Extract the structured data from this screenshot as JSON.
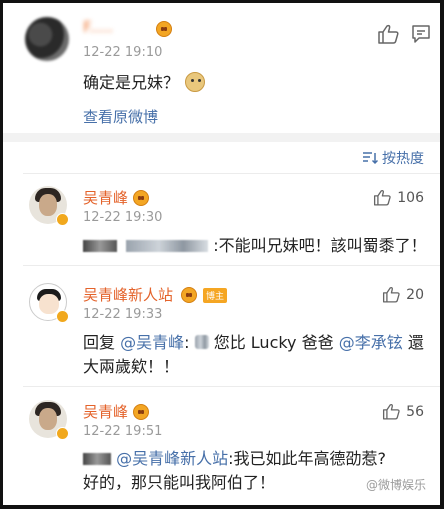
{
  "post": {
    "author_name": "F.....",
    "time": "12-22 19:10",
    "text": "确定是兄妹？",
    "view_original": "查看原微博"
  },
  "sort": {
    "label": "按热度"
  },
  "comments": [
    {
      "name": "吴青峰",
      "time": "12-22 19:30",
      "likes": "106",
      "text": ":不能叫兄妹吧！該叫蜀黍了！"
    },
    {
      "name": "吴青峰新人站",
      "badge": "博主",
      "time": "12-22 19:33",
      "likes": "20",
      "reply_prefix": "回复",
      "mention1": "@吴青峰",
      "text_a": ":",
      "text_b": "您比 Lucky 爸爸",
      "mention2": "@李承铉",
      "text_c": "還",
      "text_line2": "大兩歲欸！！"
    },
    {
      "name": "吴青峰",
      "time": "12-22 19:51",
      "likes": "56",
      "mention": "@吴青峰新人站",
      "text_line1": ":我已如此年高德劭惹?",
      "text_line2": "好的，那只能叫我阿伯了！"
    }
  ],
  "watermark": "@微博娱乐"
}
